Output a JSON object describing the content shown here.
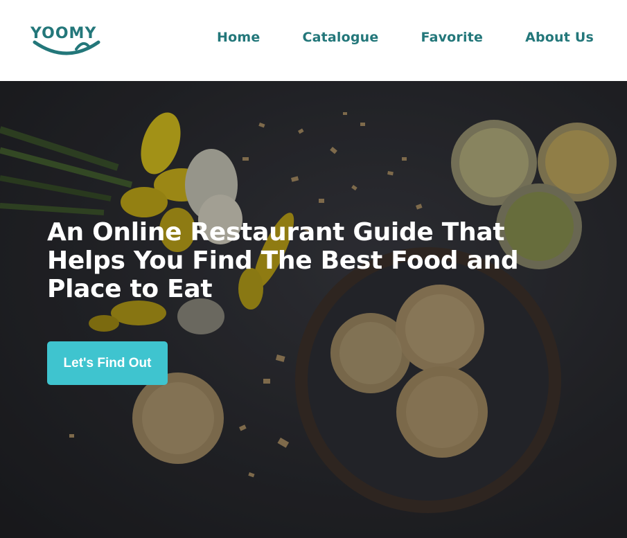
{
  "header": {
    "logo_text": "YOOMY",
    "nav": [
      {
        "label": "Home"
      },
      {
        "label": "Catalogue"
      },
      {
        "label": "Favorite"
      },
      {
        "label": "About Us"
      }
    ]
  },
  "hero": {
    "title": "An Online Restaurant Guide That Helps You Find The Best Food and Place to Eat",
    "cta_label": "Let's Find Out"
  },
  "colors": {
    "brand": "#23777a",
    "cta": "#3fc4cf",
    "hero_background": "#2b2c31"
  }
}
